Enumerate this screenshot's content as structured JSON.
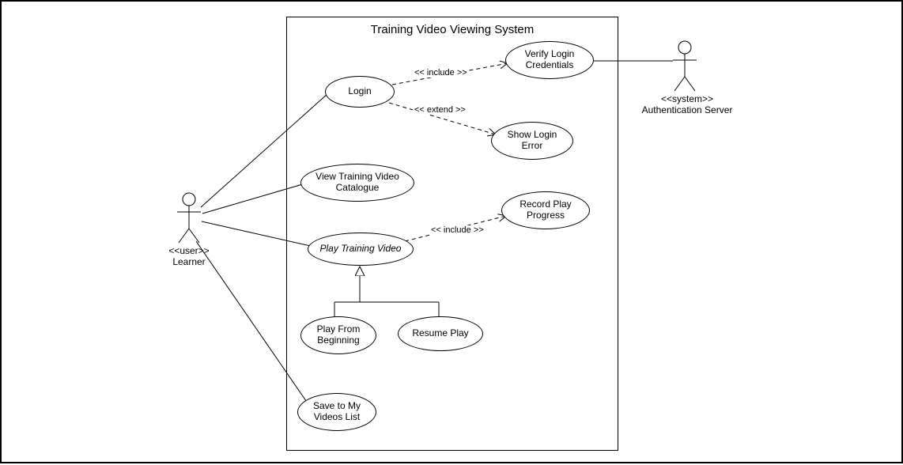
{
  "chart_data": {
    "type": "uml-use-case",
    "system": "Training Video Viewing System",
    "actors": [
      {
        "id": "learner",
        "stereotype": "user",
        "name": "Learner"
      },
      {
        "id": "authserver",
        "stereotype": "system",
        "name": "Authentication Server"
      }
    ],
    "usecases": [
      {
        "id": "login",
        "name": "Login"
      },
      {
        "id": "verify",
        "name": "Verify Login Credentials"
      },
      {
        "id": "showerror",
        "name": "Show Login Error"
      },
      {
        "id": "catalogue",
        "name": "View Training Video Catalogue"
      },
      {
        "id": "play",
        "name": "Play Training Video",
        "abstract": true
      },
      {
        "id": "record",
        "name": "Record Play Progress"
      },
      {
        "id": "frombeginning",
        "name": "Play From Beginning"
      },
      {
        "id": "resume",
        "name": "Resume Play"
      },
      {
        "id": "save",
        "name": "Save to My Videos List"
      }
    ],
    "relationships": [
      {
        "from": "learner",
        "to": "login",
        "kind": "association"
      },
      {
        "from": "learner",
        "to": "catalogue",
        "kind": "association"
      },
      {
        "from": "learner",
        "to": "play",
        "kind": "association"
      },
      {
        "from": "learner",
        "to": "save",
        "kind": "association"
      },
      {
        "from": "login",
        "to": "verify",
        "kind": "include"
      },
      {
        "from": "login",
        "to": "showerror",
        "kind": "extend"
      },
      {
        "from": "play",
        "to": "record",
        "kind": "include"
      },
      {
        "from": "frombeginning",
        "to": "play",
        "kind": "generalization"
      },
      {
        "from": "resume",
        "to": "play",
        "kind": "generalization"
      },
      {
        "from": "authserver",
        "to": "verify",
        "kind": "association"
      }
    ]
  },
  "title": "Training Video Viewing System",
  "learner": {
    "stereo": "<<user>>",
    "name": "Learner"
  },
  "auth": {
    "stereo": "<<system>>",
    "name": "Authentication Server"
  },
  "uc": {
    "login": "Login",
    "verify_l1": "Verify Login",
    "verify_l2": "Credentials",
    "showerror_l1": "Show Login",
    "showerror_l2": "Error",
    "catalogue_l1": "View Training Video",
    "catalogue_l2": "Catalogue",
    "play": "Play Training Video",
    "record_l1": "Record Play",
    "record_l2": "Progress",
    "frombeginning_l1": "Play From",
    "frombeginning_l2": "Beginning",
    "resume": "Resume Play",
    "save_l1": "Save to My",
    "save_l2": "Videos List"
  },
  "labels": {
    "include1": "<< include >>",
    "extend1": "<< extend >>",
    "include2": "<< include >>"
  }
}
